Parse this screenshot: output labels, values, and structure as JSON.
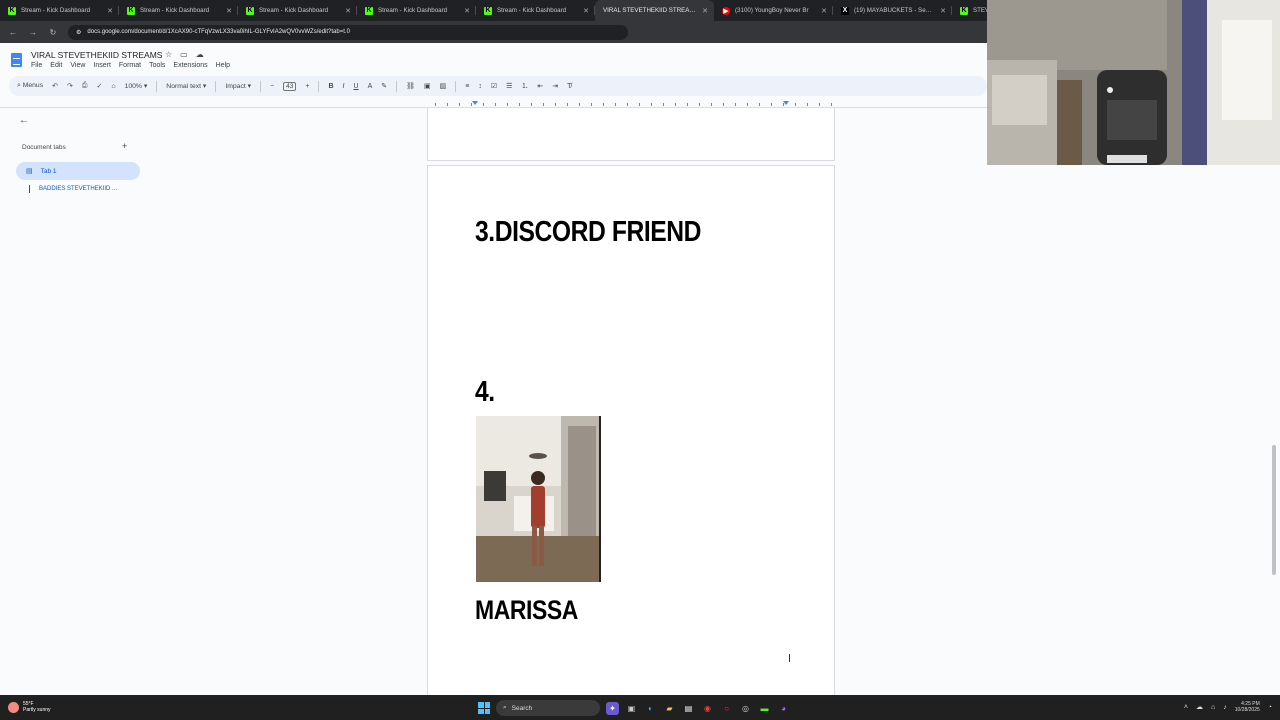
{
  "browser": {
    "tabs": [
      {
        "label": "Stream - Kick Dashboard",
        "icon": "kick-icon",
        "active": false
      },
      {
        "label": "Stream - Kick Dashboard",
        "icon": "kick-icon",
        "active": false
      },
      {
        "label": "Stream - Kick Dashboard",
        "icon": "kick-icon",
        "active": false
      },
      {
        "label": "Stream - Kick Dashboard",
        "icon": "kick-icon",
        "active": false
      },
      {
        "label": "Stream - Kick Dashboard",
        "icon": "kick-icon",
        "active": false
      },
      {
        "label": "VIRAL STEVETHEKIID STREAMS",
        "icon": "docs-icon",
        "active": true
      },
      {
        "label": "(3100) YoungBoy Never Br",
        "icon": "youtube-icon",
        "active": false
      },
      {
        "label": "(19) MAYABUCKETS - Search / X",
        "icon": "x-icon",
        "active": false
      },
      {
        "label": "STEV",
        "icon": "kick-icon",
        "active": false
      }
    ],
    "url": "docs.google.com/document/d/1XcAX90-cTFqVzwLX33va0ihIL-GLYFvIA2wQV0vvWZs/edit?tab=t.0"
  },
  "doc": {
    "title": "VIRAL STEVETHEKIID STREAMS",
    "menu": [
      "File",
      "Edit",
      "View",
      "Insert",
      "Format",
      "Tools",
      "Extensions",
      "Help"
    ],
    "toolbar": {
      "menus_label": "Menus",
      "zoom": "100%",
      "style": "Normal text",
      "font": "Impact",
      "font_size": "43"
    }
  },
  "sidebar": {
    "heading": "Document tabs",
    "tab_label": "Tab 1",
    "subtab_label": "BADDIES STEVETHEKIID ..."
  },
  "content": {
    "heading1": "3.DISCORD FRIEND",
    "heading2": "4.",
    "heading3": "MARISSA"
  },
  "taskbar": {
    "weather_temp": "55°F",
    "weather_desc": "Partly sunny",
    "search_label": "Search",
    "time": "4:25 PM",
    "date": "10/28/2025"
  },
  "colors": {
    "docs_blue": "#4285f4",
    "kick_green": "#53fc18",
    "tab_highlight": "#d3e3fd"
  }
}
